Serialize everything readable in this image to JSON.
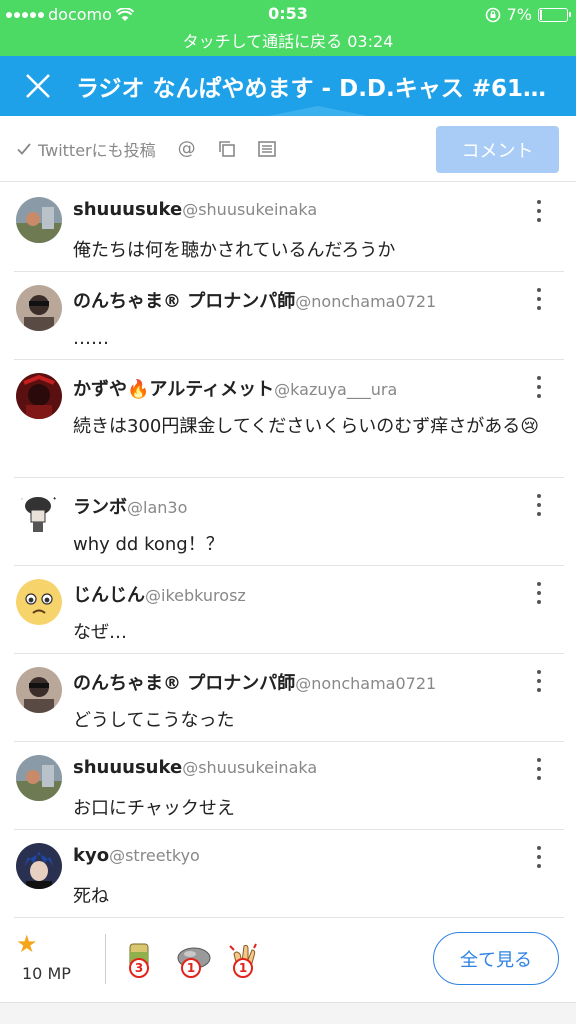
{
  "status_bar": {
    "carrier": "docomo",
    "time": "0:53",
    "battery": "7%"
  },
  "call_bar": {
    "text": "タッチして通話に戻る 03:24"
  },
  "header": {
    "title": "ラジオ なんぱやめます - D.D.キャス #61…"
  },
  "toolbar": {
    "share_label": "Twitterにも投稿",
    "comment_button": "コメント"
  },
  "comments": [
    {
      "name": "shuuusuke",
      "handle": "@shuusukeinaka",
      "text": "俺たちは何を聴かされているんだろうか"
    },
    {
      "name": "のんちゃま® プロナンパ師",
      "handle": "@nonchama0721",
      "text": "……"
    },
    {
      "name": "かずや🔥アルティメット",
      "handle": "@kazuya___ura",
      "text": "続きは300円課金してくださいくらいのむず痒さがある😢"
    },
    {
      "name": "ランボ",
      "handle": "@lan3o",
      "text": "why dd kong！？"
    },
    {
      "name": "じんじん",
      "handle": "@ikebkurosz",
      "text": "なぜ…"
    },
    {
      "name": "のんちゃま® プロナンパ師",
      "handle": "@nonchama0721",
      "text": "どうしてこうなった"
    },
    {
      "name": "shuuusuke",
      "handle": "@shuusukeinaka",
      "text": "お口にチャックせえ"
    },
    {
      "name": "kyo",
      "handle": "@streetkyo",
      "text": "死ね"
    }
  ],
  "footer": {
    "mp_label": "10 MP",
    "badges": [
      {
        "count": "3"
      },
      {
        "count": "1"
      },
      {
        "count": "1"
      }
    ],
    "see_all": "全て見る"
  },
  "colors": {
    "status_green": "#4cd964",
    "header_blue": "#1ea1e8",
    "button_disabled": "#a8ccf5",
    "link_blue": "#2d82e4"
  }
}
